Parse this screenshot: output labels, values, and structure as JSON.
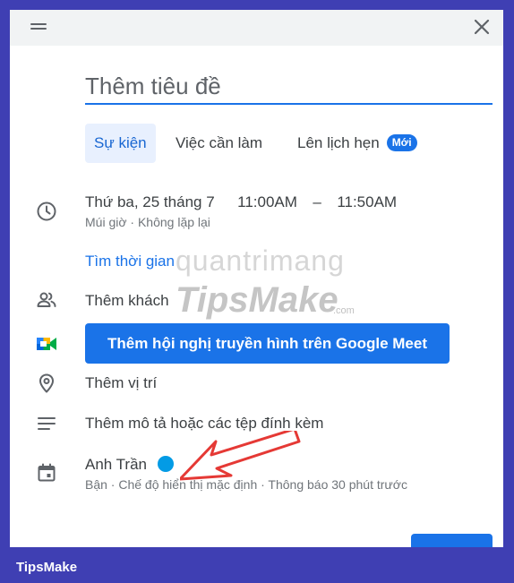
{
  "header": {
    "drag_icon": "drag-handle-icon",
    "close_icon": "close-icon"
  },
  "title": {
    "placeholder": "Thêm tiêu đề"
  },
  "tabs": [
    {
      "label": "Sự kiện",
      "active": true
    },
    {
      "label": "Việc cần làm",
      "active": false
    },
    {
      "label": "Lên lịch hẹn",
      "active": false,
      "badge": "Mới"
    }
  ],
  "datetime": {
    "date": "Thứ ba, 25 tháng 7",
    "start": "11:00AM",
    "separator": "–",
    "end": "11:50AM",
    "details": "Múi giờ · Không lặp lại",
    "find_time": "Tìm thời gian"
  },
  "guests": {
    "label": "Thêm khách"
  },
  "meet": {
    "button_label": "Thêm hội nghị truyền hình trên Google Meet"
  },
  "location": {
    "label": "Thêm vị trí"
  },
  "description": {
    "label": "Thêm mô tả hoặc các tệp đính kèm"
  },
  "calendar": {
    "owner": "Anh Trần",
    "color": "#039be5",
    "details": "Bận · Chế độ hiển thị mặc định · Thông báo 30 phút trước"
  },
  "watermark": {
    "top": "quantrimang",
    "main": "TipsMake",
    "suffix": ".com"
  },
  "footer": {
    "brand": "TipsMake"
  },
  "colors": {
    "accent": "#1a73e8",
    "frame": "#3f3fb3",
    "arrow": "#e53935"
  }
}
